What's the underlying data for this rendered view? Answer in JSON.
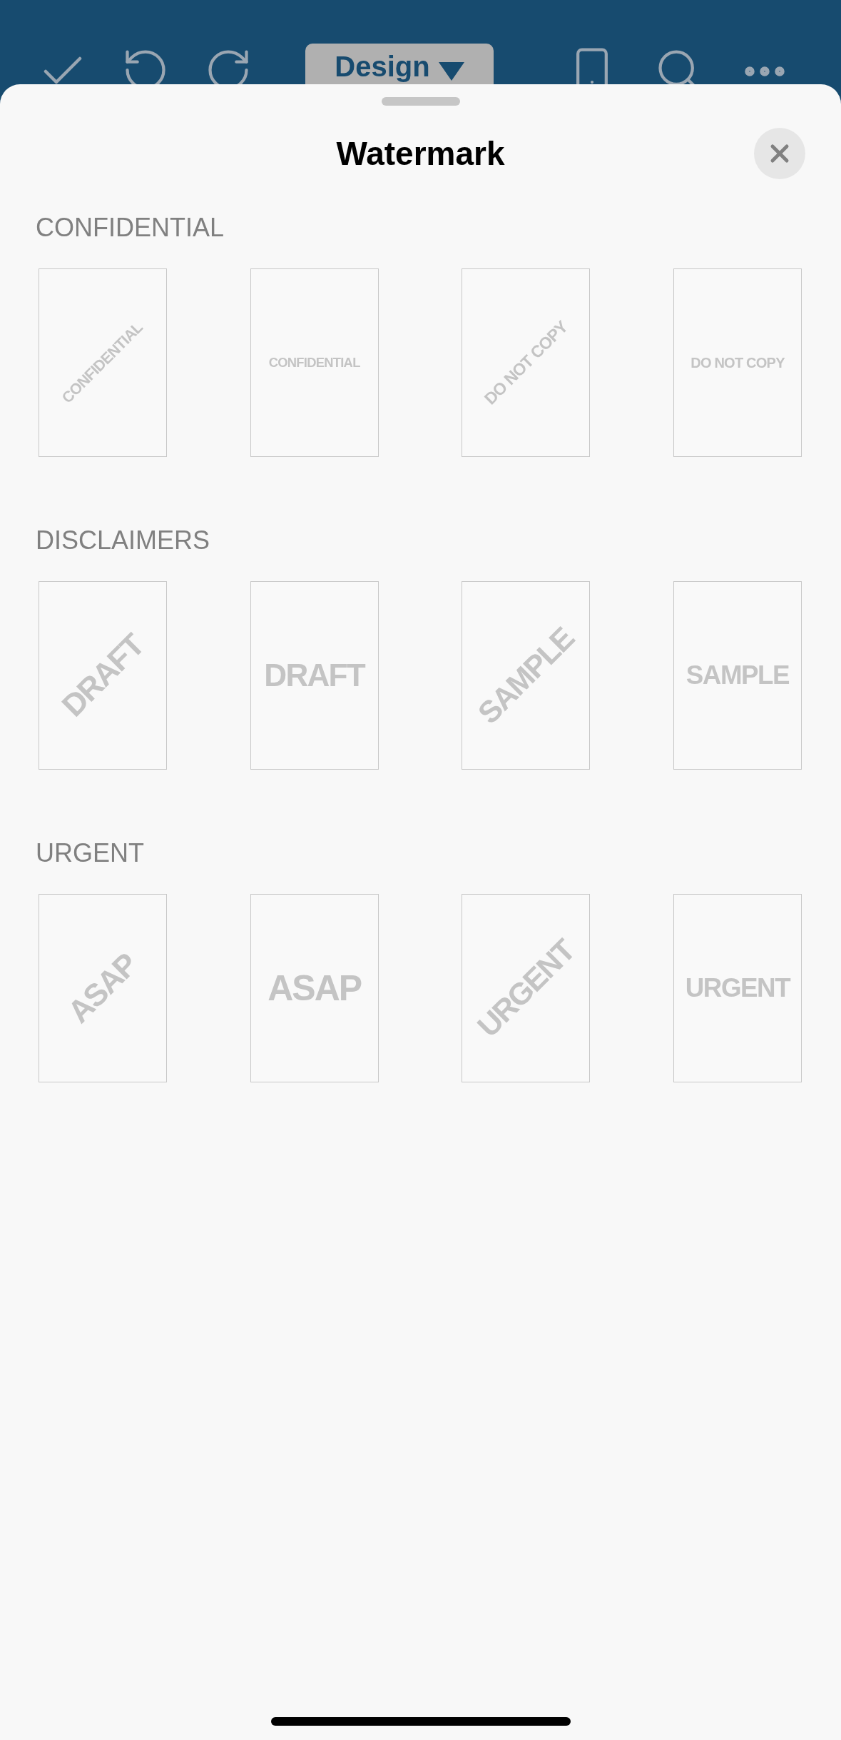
{
  "toolbar": {
    "mode_button": "Design"
  },
  "sheet": {
    "title": "Watermark"
  },
  "sections": [
    {
      "label": "CONFIDENTIAL",
      "items": [
        {
          "text": "CONFIDENTIAL",
          "kind": "diagonal"
        },
        {
          "text": "CONFIDENTIAL",
          "kind": "horizontal"
        },
        {
          "text": "DO NOT COPY",
          "kind": "diagonal"
        },
        {
          "text": "DO NOT COPY",
          "kind": "horizontal"
        }
      ]
    },
    {
      "label": "DISCLAIMERS",
      "items": [
        {
          "text": "DRAFT",
          "kind": "diagonal"
        },
        {
          "text": "DRAFT",
          "kind": "horizontal"
        },
        {
          "text": "SAMPLE",
          "kind": "diagonal"
        },
        {
          "text": "SAMPLE",
          "kind": "horizontal"
        }
      ]
    },
    {
      "label": "URGENT",
      "items": [
        {
          "text": "ASAP",
          "kind": "diagonal"
        },
        {
          "text": "ASAP",
          "kind": "horizontal"
        },
        {
          "text": "URGENT",
          "kind": "diagonal"
        },
        {
          "text": "URGENT",
          "kind": "horizontal"
        }
      ]
    }
  ]
}
